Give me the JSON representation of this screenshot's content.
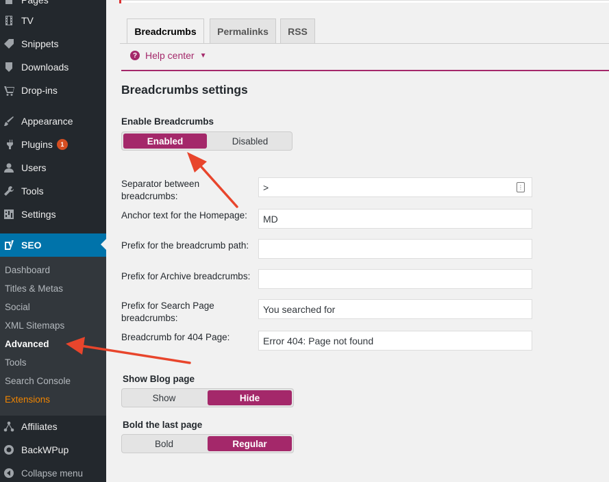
{
  "sidebar": {
    "items": [
      {
        "label": "Pages",
        "icon": "pages-icon"
      },
      {
        "label": "TV",
        "icon": "film-icon"
      },
      {
        "label": "Snippets",
        "icon": "tag-icon"
      },
      {
        "label": "Downloads",
        "icon": "download-icon"
      },
      {
        "label": "Drop-ins",
        "icon": "cart-icon"
      },
      {
        "label": "Appearance",
        "icon": "brush-icon"
      },
      {
        "label": "Plugins",
        "icon": "plugin-icon",
        "badge": "1"
      },
      {
        "label": "Users",
        "icon": "user-icon"
      },
      {
        "label": "Tools",
        "icon": "wrench-icon"
      },
      {
        "label": "Settings",
        "icon": "settings-icon"
      },
      {
        "label": "SEO",
        "icon": "yoast-icon"
      },
      {
        "label": "Affiliates",
        "icon": "share-icon"
      },
      {
        "label": "BackWPup",
        "icon": "backup-icon"
      },
      {
        "label": "Collapse menu",
        "icon": "collapse-icon"
      }
    ],
    "submenu": [
      "Dashboard",
      "Titles & Metas",
      "Social",
      "XML Sitemaps",
      "Advanced",
      "Tools",
      "Search Console",
      "Extensions"
    ],
    "submenu_current": "Advanced"
  },
  "tabs": [
    "Breadcrumbs",
    "Permalinks",
    "RSS"
  ],
  "active_tab": "Breadcrumbs",
  "help": {
    "label": "Help center"
  },
  "section_title": "Breadcrumbs settings",
  "enable": {
    "label": "Enable Breadcrumbs",
    "options": [
      "Enabled",
      "Disabled"
    ],
    "selected": "Enabled"
  },
  "fields": [
    {
      "label_lines": [
        "Separator between",
        "breadcrumbs:"
      ],
      "value": ">"
    },
    {
      "label_lines": [
        "Anchor text for the Homepage:"
      ],
      "value": "MD"
    },
    {
      "label_lines": [
        "Prefix for the breadcrumb path:"
      ],
      "value": ""
    },
    {
      "label_lines": [
        "Prefix for Archive breadcrumbs:"
      ],
      "value": ""
    },
    {
      "label_lines": [
        "Prefix for Search Page",
        "breadcrumbs:"
      ],
      "value": "You searched for"
    },
    {
      "label_lines": [
        "Breadcrumb for 404 Page:"
      ],
      "value": "Error 404: Page not found"
    }
  ],
  "show_blog": {
    "label": "Show Blog page",
    "options": [
      "Show",
      "Hide"
    ],
    "selected": "Hide"
  },
  "bold_last": {
    "label": "Bold the last page",
    "options": [
      "Bold",
      "Regular"
    ],
    "selected": "Regular"
  },
  "colors": {
    "sidebar_bg": "#23282d",
    "submenu_bg": "#32373c",
    "seo_active": "#0073aa",
    "accent_purple": "#a4286a",
    "extensions_orange": "#f18500",
    "annotation_arrow": "#e8452c"
  }
}
